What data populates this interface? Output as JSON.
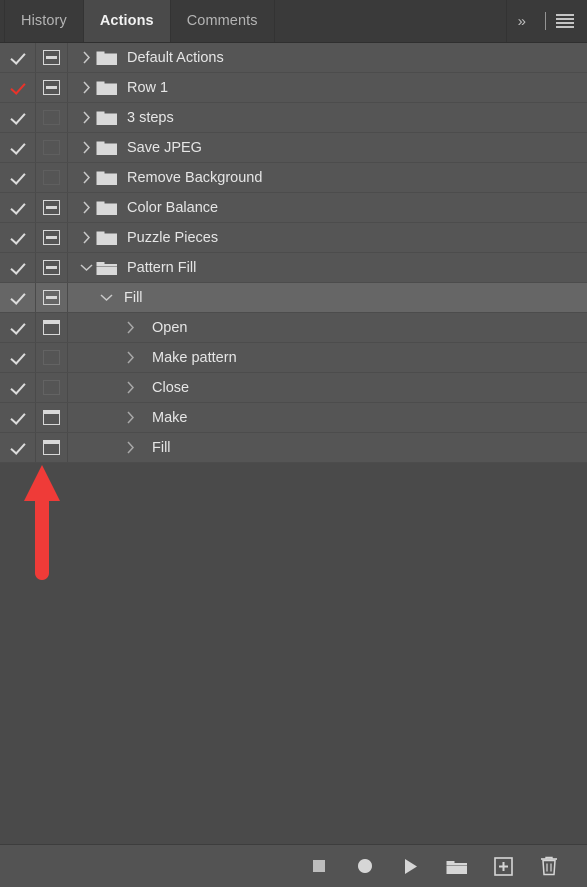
{
  "panel": {
    "title": "Actions"
  },
  "tabs": [
    {
      "label": "History",
      "active": false
    },
    {
      "label": "Actions",
      "active": true
    },
    {
      "label": "Comments",
      "active": false
    }
  ],
  "header_controls": {
    "expand_label": "»",
    "menu_icon": "hamburger-menu-icon"
  },
  "rows": [
    {
      "label": "Default Actions",
      "checked": true,
      "check_color": "#dcdcdc",
      "dialog": "modal",
      "dialog_dim": false,
      "expanded": false,
      "icon": "folder-closed-icon",
      "indent": 0
    },
    {
      "label": "Row 1",
      "checked": true,
      "check_color": "#e8332a",
      "dialog": "modal",
      "dialog_dim": false,
      "expanded": false,
      "icon": "folder-closed-icon",
      "indent": 0
    },
    {
      "label": "3 steps",
      "checked": true,
      "check_color": "#dcdcdc",
      "dialog": "none",
      "dialog_dim": true,
      "expanded": false,
      "icon": "folder-closed-icon",
      "indent": 0
    },
    {
      "label": "Save JPEG",
      "checked": true,
      "check_color": "#dcdcdc",
      "dialog": "none",
      "dialog_dim": true,
      "expanded": false,
      "icon": "folder-closed-icon",
      "indent": 0
    },
    {
      "label": "Remove Background",
      "checked": true,
      "check_color": "#dcdcdc",
      "dialog": "none",
      "dialog_dim": true,
      "expanded": false,
      "icon": "folder-closed-icon",
      "indent": 0
    },
    {
      "label": "Color Balance",
      "checked": true,
      "check_color": "#dcdcdc",
      "dialog": "modal",
      "dialog_dim": false,
      "expanded": false,
      "icon": "folder-closed-icon",
      "indent": 0
    },
    {
      "label": "Puzzle Pieces",
      "checked": true,
      "check_color": "#dcdcdc",
      "dialog": "modal",
      "dialog_dim": false,
      "expanded": false,
      "icon": "folder-closed-icon",
      "indent": 0
    },
    {
      "label": "Pattern Fill",
      "checked": true,
      "check_color": "#dcdcdc",
      "dialog": "modal",
      "dialog_dim": false,
      "expanded": true,
      "icon": "folder-open-icon",
      "indent": 0
    },
    {
      "label": "Fill",
      "checked": true,
      "check_color": "#dcdcdc",
      "dialog": "modal",
      "dialog_dim": false,
      "expanded": true,
      "icon": "none",
      "indent": 1,
      "selected": true
    },
    {
      "label": "Open",
      "checked": true,
      "check_color": "#dcdcdc",
      "dialog": "bar",
      "dialog_dim": false,
      "expanded": false,
      "icon": "none",
      "indent": 2
    },
    {
      "label": "Make pattern",
      "checked": true,
      "check_color": "#dcdcdc",
      "dialog": "none",
      "dialog_dim": true,
      "expanded": false,
      "icon": "none",
      "indent": 2
    },
    {
      "label": "Close",
      "checked": true,
      "check_color": "#dcdcdc",
      "dialog": "none",
      "dialog_dim": true,
      "expanded": false,
      "icon": "none",
      "indent": 2
    },
    {
      "label": "Make",
      "checked": true,
      "check_color": "#dcdcdc",
      "dialog": "bar",
      "dialog_dim": false,
      "expanded": false,
      "icon": "none",
      "indent": 2
    },
    {
      "label": "Fill",
      "checked": true,
      "check_color": "#dcdcdc",
      "dialog": "bar",
      "dialog_dim": false,
      "expanded": false,
      "icon": "none",
      "indent": 2
    }
  ],
  "annotation": {
    "type": "arrow-up",
    "color": "#ef3b38",
    "points_to": "dialog-toggle-of-last-fill-row"
  },
  "toolbar": [
    {
      "name": "stop-button",
      "icon": "stop-square-icon"
    },
    {
      "name": "record-button",
      "icon": "record-circle-icon"
    },
    {
      "name": "play-button",
      "icon": "play-triangle-icon"
    },
    {
      "name": "new-set-button",
      "icon": "folder-icon"
    },
    {
      "name": "new-action-button",
      "icon": "plus-square-icon"
    },
    {
      "name": "delete-button",
      "icon": "trash-icon"
    }
  ],
  "colors": {
    "panel_bg": "#4a4a4a",
    "row_bg": "#555555",
    "row_selected_bg": "#666666",
    "tabbar_bg": "#3a3a3a",
    "text": "#e6e6e6",
    "accent_red": "#e8332a",
    "annotation_red": "#ef3b38"
  }
}
